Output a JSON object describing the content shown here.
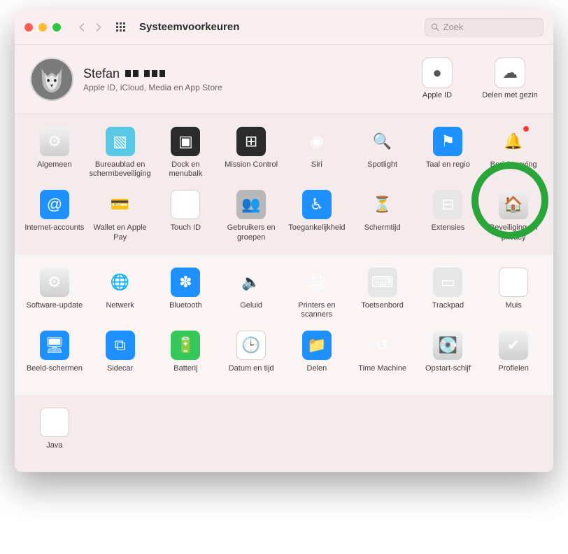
{
  "window": {
    "title": "Systeemvoorkeuren"
  },
  "search": {
    "placeholder": "Zoek"
  },
  "account": {
    "name": "Stefan",
    "subtitle": "Apple ID, iCloud, Media en App Store",
    "right": [
      {
        "label": "Apple ID",
        "icon": "apple-logo-icon"
      },
      {
        "label": "Delen met gezin",
        "icon": "family-icon"
      }
    ]
  },
  "sections": [
    {
      "items": [
        {
          "label": "Algemeen",
          "icon": "general-icon",
          "bg": "bg-silver"
        },
        {
          "label": "Bureaublad en schermbeveiliging",
          "icon": "desktop-icon",
          "bg": "bg-teal"
        },
        {
          "label": "Dock en menubalk",
          "icon": "dock-icon",
          "bg": "bg-dark"
        },
        {
          "label": "Mission Control",
          "icon": "mission-control-icon",
          "bg": "bg-dark"
        },
        {
          "label": "Siri",
          "icon": "siri-icon",
          "bg": "bg-none"
        },
        {
          "label": "Spotlight",
          "icon": "spotlight-icon",
          "bg": "bg-none"
        },
        {
          "label": "Taal en regio",
          "icon": "language-icon",
          "bg": "bg-blue"
        },
        {
          "label": "Berichtgeving",
          "icon": "notifications-icon",
          "bg": "bg-none",
          "badge": true
        },
        {
          "label": "Internet-accounts",
          "icon": "at-icon",
          "bg": "bg-blue"
        },
        {
          "label": "Wallet en Apple Pay",
          "icon": "wallet-icon",
          "bg": "bg-none"
        },
        {
          "label": "Touch ID",
          "icon": "fingerprint-icon",
          "bg": "bg-white"
        },
        {
          "label": "Gebruikers en groepen",
          "icon": "users-icon",
          "bg": "bg-grey"
        },
        {
          "label": "Toegankelijkheid",
          "icon": "accessibility-icon",
          "bg": "bg-blue"
        },
        {
          "label": "Schermtijd",
          "icon": "screentime-icon",
          "bg": "bg-none"
        },
        {
          "label": "Extensies",
          "icon": "extensions-icon",
          "bg": "bg-lgrey"
        },
        {
          "label": "Beveiliging en privacy",
          "icon": "security-icon",
          "bg": "bg-silver",
          "highlight": true
        }
      ]
    },
    {
      "items": [
        {
          "label": "Software-update",
          "icon": "update-icon",
          "bg": "bg-silver"
        },
        {
          "label": "Netwerk",
          "icon": "network-icon",
          "bg": "bg-none"
        },
        {
          "label": "Bluetooth",
          "icon": "bluetooth-icon",
          "bg": "bg-blue"
        },
        {
          "label": "Geluid",
          "icon": "sound-icon",
          "bg": "bg-none"
        },
        {
          "label": "Printers en scanners",
          "icon": "printer-icon",
          "bg": "bg-none"
        },
        {
          "label": "Toetsenbord",
          "icon": "keyboard-icon",
          "bg": "bg-lgrey"
        },
        {
          "label": "Trackpad",
          "icon": "trackpad-icon",
          "bg": "bg-lgrey"
        },
        {
          "label": "Muis",
          "icon": "mouse-icon",
          "bg": "bg-white"
        },
        {
          "label": "Beeld-schermen",
          "icon": "display-icon",
          "bg": "bg-blue"
        },
        {
          "label": "Sidecar",
          "icon": "sidecar-icon",
          "bg": "bg-blue"
        },
        {
          "label": "Batterij",
          "icon": "battery-icon",
          "bg": "bg-green"
        },
        {
          "label": "Datum en tijd",
          "icon": "clock-icon",
          "bg": "bg-white"
        },
        {
          "label": "Delen",
          "icon": "share-icon",
          "bg": "bg-blue"
        },
        {
          "label": "Time Machine",
          "icon": "timemachine-icon",
          "bg": "bg-none"
        },
        {
          "label": "Opstart-schijf",
          "icon": "startup-icon",
          "bg": "bg-silver"
        },
        {
          "label": "Profielen",
          "icon": "profiles-icon",
          "bg": "bg-silver"
        }
      ]
    },
    {
      "items": [
        {
          "label": "Java",
          "icon": "java-icon",
          "bg": "bg-white"
        }
      ]
    }
  ]
}
